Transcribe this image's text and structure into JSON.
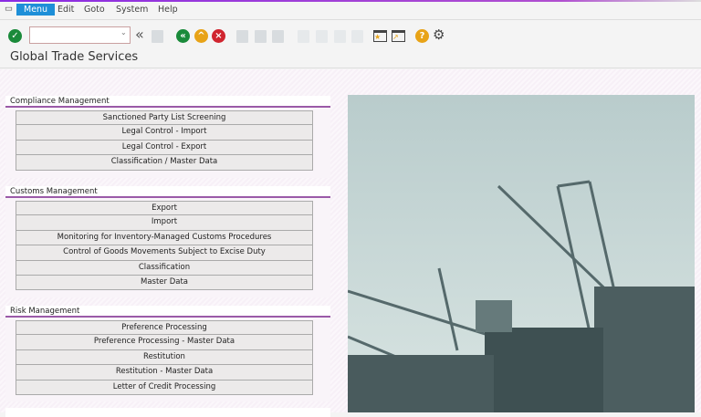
{
  "menu": {
    "items": [
      "Menu",
      "Edit",
      "Goto",
      "System",
      "Help"
    ]
  },
  "page": {
    "title": "Global Trade Services"
  },
  "toolbar": {
    "command_field": ""
  },
  "sections": [
    {
      "title": "Compliance Management",
      "items": [
        "Sanctioned Party List Screening",
        "Legal Control - Import",
        "Legal Control - Export",
        "Classification / Master Data"
      ]
    },
    {
      "title": "Customs Management",
      "items": [
        "Export",
        "Import",
        "Monitoring for Inventory-Managed Customs Procedures",
        "Control of Goods Movements Subject to Excise Duty",
        "Classification",
        "Master Data"
      ]
    },
    {
      "title": "Risk Management",
      "items": [
        "Preference Processing",
        "Preference Processing - Master Data",
        "Restitution",
        "Restitution - Master Data",
        "Letter of Credit Processing"
      ]
    }
  ],
  "colors": {
    "accent": "#9b5aa8",
    "menu_active": "#1e8fd8"
  }
}
